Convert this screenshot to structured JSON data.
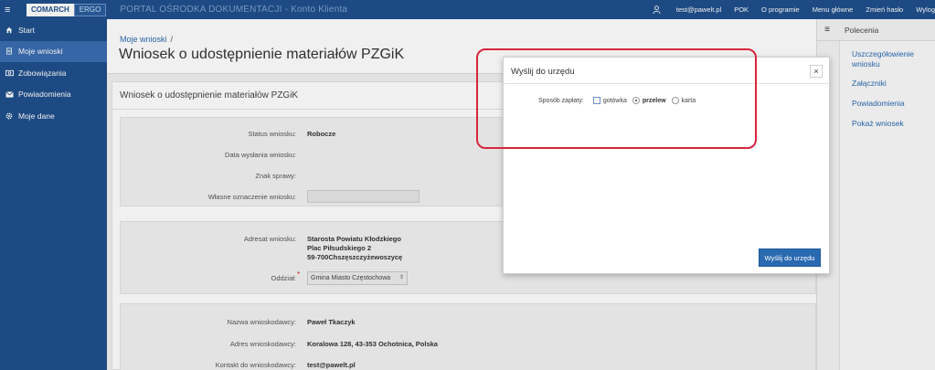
{
  "app": {
    "logo_brand": "COMARCH",
    "logo_product": "ERGO",
    "portal_title": "PORTAL OŚRODKA DOKUMENTACJI - Konto Klienta"
  },
  "topnav": {
    "user": "test@pawelt.pl",
    "items": [
      "POK",
      "O programie",
      "Menu główne",
      "Zmień hasło",
      "Wylog"
    ]
  },
  "sidebar": {
    "items": [
      {
        "label": "Start",
        "icon": "home-icon"
      },
      {
        "label": "Moje wnioski",
        "icon": "document-icon",
        "active": true
      },
      {
        "label": "Zobowiązania",
        "icon": "money-icon"
      },
      {
        "label": "Powiadomienia",
        "icon": "envelope-icon"
      },
      {
        "label": "Moje dane",
        "icon": "gear-icon"
      }
    ]
  },
  "main": {
    "breadcrumb": "Moje wnioski",
    "breadcrumb_sep": "/",
    "title": "Wniosek o udostępnienie materiałów PZGiK",
    "panel_title": "Wniosek o udostępnienie materiałów PZGiK",
    "status": {
      "status_label": "Status wniosku:",
      "status_value": "Robocze",
      "sent_label": "Data wysłania wniosku:",
      "case_label": "Znak sprawy:",
      "own_label": "Własne oznaczenie wniosku:",
      "own_value": ""
    },
    "address": {
      "addressee_label": "Adresat wniosku:",
      "addressee_lines": [
        "Starosta Powiatu Kłodzkiego",
        "Plac Piłsudskiego 2",
        "59-700Chszęszczyżewoszycę"
      ],
      "branch_label": "Oddział:",
      "branch_value": "Gmina Miasto Częstochowa",
      "required_mark": "*"
    },
    "applicant": {
      "name_label": "Nazwa wnioskodawcy:",
      "name_value": "Paweł Tkaczyk",
      "addr_label": "Adres wnioskodawcy:",
      "addr_value": "Koralowa 128, 43-353 Ochotnica, Polska",
      "contact_label": "Kontakt do wnioskodawcy:",
      "contact_value": "test@pawelt.pl"
    }
  },
  "rightbar": {
    "title": "Polecenia",
    "links": [
      "Uszczegółowienie wniosku",
      "Załączniki",
      "Powiadomienia",
      "Pokaż wniosek"
    ]
  },
  "modal": {
    "title": "Wyślij do urzędu",
    "close": "×",
    "payment_label": "Sposób zapłaty:",
    "options": [
      {
        "label": "gotówka",
        "type": "checkbox",
        "selected": false
      },
      {
        "label": "przelew",
        "type": "radio",
        "selected": true
      },
      {
        "label": "karta",
        "type": "radio",
        "selected": false
      }
    ],
    "send_button": "Wyślij do urzędu"
  },
  "colors": {
    "primary": "#1f4f8c",
    "active": "#3a6db0",
    "link": "#2a6ab1",
    "highlight": "#d7263d"
  }
}
